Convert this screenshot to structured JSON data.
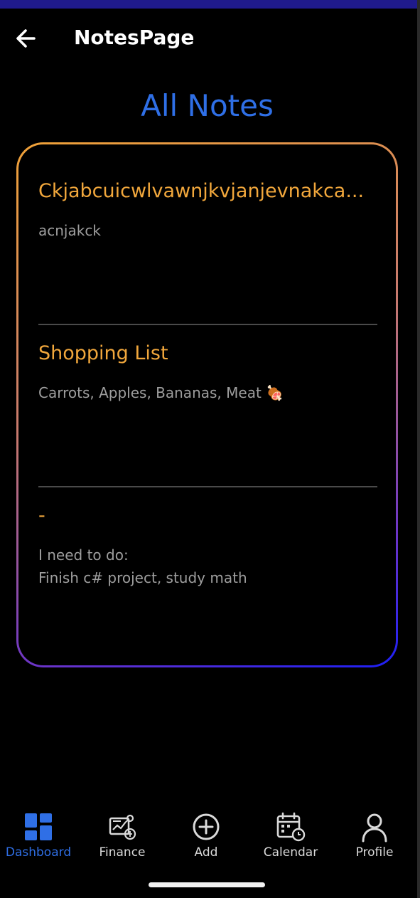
{
  "status_bar": {
    "color": "#1f1a8c"
  },
  "top_bar": {
    "back_icon": "arrow-left-icon",
    "title": "NotesPage"
  },
  "page_heading": "All Notes",
  "colors": {
    "heading_blue": "#2f6fe6",
    "note_title_orange": "#f1a73c",
    "note_body_gray": "#9e9e9e",
    "card_gradient_start": "#f0a238",
    "card_gradient_end": "#1d1ff5"
  },
  "notes": [
    {
      "title": "Ckjabcuicwlvawnjkvjanjevnakca...",
      "body": "acnjakck"
    },
    {
      "title": "Shopping List",
      "body": "Carrots, Apples, Bananas, Meat 🍖"
    },
    {
      "title": "-",
      "body": "I need to do:\nFinish c# project, study math"
    }
  ],
  "bottom_nav": {
    "items": [
      {
        "label": "Dashboard",
        "icon": "dashboard-grid-icon",
        "active": true
      },
      {
        "label": "Finance",
        "icon": "finance-chart-icon",
        "active": false
      },
      {
        "label": "Add",
        "icon": "add-circle-icon",
        "active": false
      },
      {
        "label": "Calendar",
        "icon": "calendar-clock-icon",
        "active": false
      },
      {
        "label": "Profile",
        "icon": "person-icon",
        "active": false
      }
    ]
  }
}
